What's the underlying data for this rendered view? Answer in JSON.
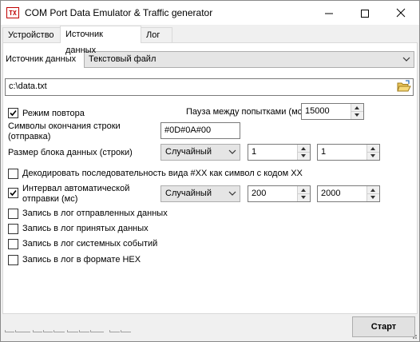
{
  "window": {
    "title": "COM Port Data Emulator & Traffic generator",
    "icon_text": "TX",
    "minimize_glyph": "—",
    "maximize_glyph": "☐",
    "close_glyph": "✕"
  },
  "tabs": [
    {
      "label": "Устройство",
      "active": false
    },
    {
      "label": "Источник данных",
      "active": true
    },
    {
      "label": "Лог",
      "active": false
    }
  ],
  "source": {
    "label": "Источник данных",
    "selected": "Текстовый файл"
  },
  "file": {
    "path": "c:\\data.txt",
    "browse_icon": "folder-open-icon"
  },
  "repeat": {
    "label": "Режим повтора",
    "checked": true,
    "pause_label": "Пауза между попытками (мс)",
    "pause_value": "15000"
  },
  "line_end": {
    "label": "Символы окончания строки (отправка)",
    "value": "#0D#0A#00"
  },
  "block_size": {
    "label": "Размер блока данных (строки)",
    "mode": "Случайный",
    "min": "1",
    "max": "1"
  },
  "decode": {
    "label": "Декодировать последовательность вида #XX как символ с кодом XX",
    "checked": false
  },
  "interval": {
    "label": "Интервал автоматической отправки (мс)",
    "checked": true,
    "mode": "Случайный",
    "min": "200",
    "max": "2000"
  },
  "log_options": [
    {
      "label": "Запись в лог отправленных данных",
      "checked": false
    },
    {
      "label": "Запись в лог принятых данных",
      "checked": false
    },
    {
      "label": "Запись в лог системных событий",
      "checked": false
    },
    {
      "label": "Запись в лог в формате HEX",
      "checked": false
    }
  ],
  "start_button": "Старт",
  "colors": {
    "window_bg": "#f0f0f0",
    "panel_bg": "#ffffff",
    "combo_bg": "#e5e5e5",
    "icon_red": "#c00000"
  }
}
